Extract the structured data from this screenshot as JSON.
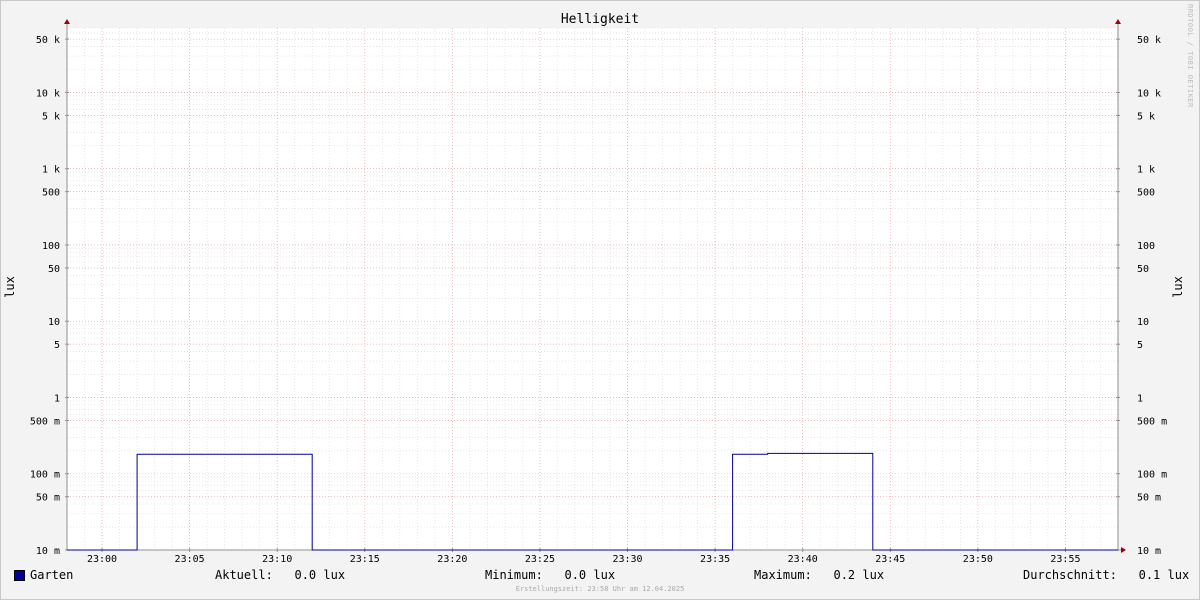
{
  "chart_data": {
    "type": "line",
    "title": "Helligkeit",
    "ylabel": "lux",
    "ylabel_right": "lux",
    "y_scale": "log",
    "ylim": [
      0.01,
      70000
    ],
    "y_ticks": [
      {
        "value": 50000,
        "label": "50 k"
      },
      {
        "value": 10000,
        "label": "10 k"
      },
      {
        "value": 5000,
        "label": "5 k"
      },
      {
        "value": 1000,
        "label": "1 k"
      },
      {
        "value": 500,
        "label": "500"
      },
      {
        "value": 100,
        "label": "100"
      },
      {
        "value": 50,
        "label": "50"
      },
      {
        "value": 10,
        "label": "10"
      },
      {
        "value": 5,
        "label": "5"
      },
      {
        "value": 1,
        "label": "1"
      },
      {
        "value": 0.5,
        "label": "500 m"
      },
      {
        "value": 0.1,
        "label": "100 m"
      },
      {
        "value": 0.05,
        "label": "50 m"
      },
      {
        "value": 0.01,
        "label": "10 m"
      }
    ],
    "xlim": [
      "22:58",
      "23:58"
    ],
    "x_ticks": [
      "23:00",
      "23:05",
      "23:10",
      "23:15",
      "23:20",
      "23:25",
      "23:30",
      "23:35",
      "23:40",
      "23:45",
      "23:50",
      "23:55"
    ],
    "grid": true,
    "series": [
      {
        "name": "Garten",
        "color": "#00009c",
        "points": [
          [
            "22:58",
            0.01
          ],
          [
            "23:02",
            0.01
          ],
          [
            "23:02",
            0.18
          ],
          [
            "23:12",
            0.18
          ],
          [
            "23:12",
            0.01
          ],
          [
            "23:36",
            0.01
          ],
          [
            "23:36",
            0.18
          ],
          [
            "23:38",
            0.18
          ],
          [
            "23:38",
            0.185
          ],
          [
            "23:44",
            0.185
          ],
          [
            "23:44",
            0.01
          ],
          [
            "23:58",
            0.01
          ]
        ]
      }
    ]
  },
  "legend": {
    "series_name": "Garten",
    "aktuell": "Aktuell:   0.0 lux",
    "minimum": "Minimum:   0.0 lux",
    "maximum": "Maximum:   0.2 lux",
    "durchschnitt": "Durchschnitt:   0.1 lux"
  },
  "footer": "Erstellungszeit: 23:58 Uhr am 12.04.2025",
  "watermark": "RRDTOOL / TOBI OETIKER"
}
